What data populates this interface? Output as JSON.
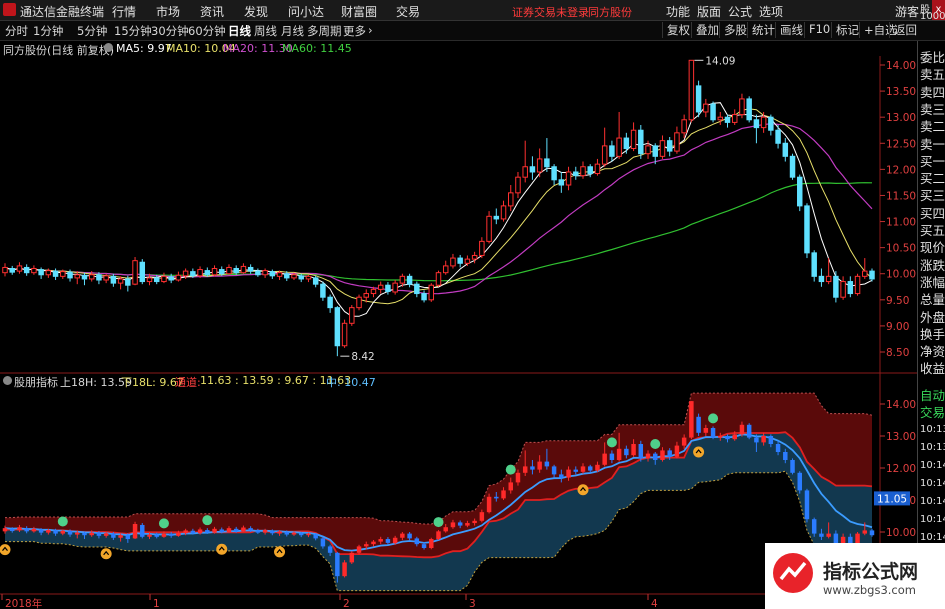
{
  "app": {
    "title": "通达信金融终端",
    "menu": [
      "行情",
      "市场",
      "资讯",
      "发现",
      "问小达",
      "财富圈",
      "交易"
    ],
    "notice": "证券交易未登录",
    "stock_name": "同方股份",
    "right_menu": [
      "功能",
      "版面",
      "公式",
      "选项"
    ],
    "user": "游客",
    "close_label": "x"
  },
  "toolbar": {
    "periods": [
      "分时",
      "1分钟",
      "5分钟",
      "15分钟",
      "30分钟",
      "60分钟",
      "日线",
      "周线",
      "月线",
      "多周期",
      "更多"
    ],
    "active_period": "日线",
    "more_arrow": "›",
    "buttons": [
      "复权",
      "叠加",
      "多股",
      "统计",
      "画线",
      "F10",
      "标记",
      "+自选",
      "返回"
    ]
  },
  "main_info": {
    "title": "同方股份(日线 前复权)",
    "ma5": "MA5: 9.97",
    "ma10": "MA10: 10.04",
    "ma20": "MA20: 11.30",
    "ma60": "MA60: 11.45"
  },
  "indicator_info": {
    "name": "股朋指标",
    "upper": "上18H: 13.59",
    "lower": "下18L: 9.67",
    "channel_label": "通道:",
    "channel_values": "11.63 : 13.59 : 9.67 : 11.63",
    "mid": "中: 10.47"
  },
  "side_panel": {
    "top_small": "股",
    "top_small2": "1000",
    "items": [
      "委比",
      "卖五",
      "卖四",
      "卖三",
      "卖二",
      "卖一",
      "买一",
      "买二",
      "买三",
      "买四",
      "买五",
      "现价",
      "涨跌",
      "涨幅",
      "总量",
      "外盘",
      "换手",
      "净资",
      "收益"
    ],
    "lower_items": [
      "自动",
      "交易"
    ],
    "times": [
      "10:13",
      "10:13",
      "10:14",
      "10:14",
      "10:14",
      "10:14",
      "10:14"
    ]
  },
  "axis": {
    "price_ticks": [
      "14.00",
      "13.50",
      "13.00",
      "12.50",
      "12.00",
      "11.50",
      "11.00",
      "10.50",
      "10.00",
      "9.50",
      "9.00",
      "8.50"
    ],
    "ind_ticks": [
      "14.00",
      "13.00",
      "12.00",
      "11.00",
      "10.00"
    ],
    "ind_current": "11.05",
    "x_labels": [
      "2018年",
      "1",
      "2",
      "3",
      "4"
    ],
    "high_label": "14.09",
    "low_label": "8.42"
  },
  "watermark": {
    "title": "指标公式网",
    "url": "www.zbgs3.com"
  },
  "chart_data": {
    "type": "candlestick",
    "ma_legend": [
      "MA5",
      "MA10",
      "MA20",
      "MA60"
    ],
    "ma_values": [
      9.97,
      10.04,
      11.3,
      11.45
    ],
    "colors": {
      "up": "#ff3030",
      "down": "#5fe0ff",
      "ma5": "#ffffff",
      "ma10": "#e8e06a",
      "ma20": "#c23cc2",
      "ma60": "#30c030"
    },
    "candles": [
      {
        "o": 10.02,
        "c": 10.12,
        "h": 10.2,
        "l": 9.95
      },
      {
        "o": 10.1,
        "c": 10.03,
        "h": 10.15,
        "l": 9.98
      },
      {
        "o": 10.05,
        "c": 10.15,
        "h": 10.22,
        "l": 10.0
      },
      {
        "o": 10.12,
        "c": 10.02,
        "h": 10.18,
        "l": 9.96
      },
      {
        "o": 10.02,
        "c": 10.1,
        "h": 10.16,
        "l": 9.98
      },
      {
        "o": 10.08,
        "c": 9.98,
        "h": 10.12,
        "l": 9.9
      },
      {
        "o": 9.98,
        "c": 10.06,
        "h": 10.1,
        "l": 9.92
      },
      {
        "o": 10.05,
        "c": 9.95,
        "h": 10.1,
        "l": 9.88
      },
      {
        "o": 9.95,
        "c": 10.04,
        "h": 10.08,
        "l": 9.9
      },
      {
        "o": 10.03,
        "c": 9.92,
        "h": 10.08,
        "l": 9.85
      },
      {
        "o": 9.92,
        "c": 9.98,
        "h": 10.05,
        "l": 9.8
      },
      {
        "o": 9.97,
        "c": 9.9,
        "h": 10.02,
        "l": 9.78
      },
      {
        "o": 9.9,
        "c": 9.98,
        "h": 10.05,
        "l": 9.85
      },
      {
        "o": 9.98,
        "c": 9.88,
        "h": 10.03,
        "l": 9.8
      },
      {
        "o": 9.88,
        "c": 9.96,
        "h": 10.0,
        "l": 9.82
      },
      {
        "o": 9.95,
        "c": 9.82,
        "h": 10.0,
        "l": 9.75
      },
      {
        "o": 9.82,
        "c": 9.9,
        "h": 9.95,
        "l": 9.7
      },
      {
        "o": 9.9,
        "c": 9.78,
        "h": 9.96,
        "l": 9.66
      },
      {
        "o": 9.8,
        "c": 10.25,
        "h": 10.32,
        "l": 9.78
      },
      {
        "o": 10.22,
        "c": 9.85,
        "h": 10.28,
        "l": 9.8
      },
      {
        "o": 9.85,
        "c": 9.92,
        "h": 10.0,
        "l": 9.78
      },
      {
        "o": 9.92,
        "c": 9.85,
        "h": 9.98,
        "l": 9.8
      },
      {
        "o": 9.85,
        "c": 9.95,
        "h": 10.02,
        "l": 9.82
      },
      {
        "o": 9.94,
        "c": 9.88,
        "h": 10.0,
        "l": 9.82
      },
      {
        "o": 9.88,
        "c": 9.97,
        "h": 10.04,
        "l": 9.85
      },
      {
        "o": 9.96,
        "c": 10.05,
        "h": 10.1,
        "l": 9.9
      },
      {
        "o": 10.04,
        "c": 9.96,
        "h": 10.1,
        "l": 9.92
      },
      {
        "o": 9.96,
        "c": 10.08,
        "h": 10.14,
        "l": 9.92
      },
      {
        "o": 10.06,
        "c": 9.98,
        "h": 10.12,
        "l": 9.94
      },
      {
        "o": 9.98,
        "c": 10.1,
        "h": 10.16,
        "l": 9.95
      },
      {
        "o": 10.08,
        "c": 10.0,
        "h": 10.14,
        "l": 9.96
      },
      {
        "o": 10.0,
        "c": 10.12,
        "h": 10.18,
        "l": 9.98
      },
      {
        "o": 10.1,
        "c": 10.02,
        "h": 10.16,
        "l": 9.98
      },
      {
        "o": 10.02,
        "c": 10.14,
        "h": 10.2,
        "l": 10.0
      },
      {
        "o": 10.12,
        "c": 10.05,
        "h": 10.18,
        "l": 10.0
      },
      {
        "o": 10.05,
        "c": 9.98,
        "h": 10.1,
        "l": 9.94
      },
      {
        "o": 9.98,
        "c": 10.06,
        "h": 10.1,
        "l": 9.92
      },
      {
        "o": 10.04,
        "c": 9.96,
        "h": 10.08,
        "l": 9.9
      },
      {
        "o": 9.95,
        "c": 10.02,
        "h": 10.06,
        "l": 9.88
      },
      {
        "o": 10.0,
        "c": 9.92,
        "h": 10.05,
        "l": 9.86
      },
      {
        "o": 9.92,
        "c": 9.98,
        "h": 10.02,
        "l": 9.88
      },
      {
        "o": 9.96,
        "c": 9.9,
        "h": 10.0,
        "l": 9.84
      },
      {
        "o": 9.9,
        "c": 9.95,
        "h": 9.98,
        "l": 9.84
      },
      {
        "o": 9.92,
        "c": 9.8,
        "h": 9.96,
        "l": 9.74
      },
      {
        "o": 9.8,
        "c": 9.55,
        "h": 9.85,
        "l": 9.48
      },
      {
        "o": 9.55,
        "c": 9.35,
        "h": 9.6,
        "l": 9.25
      },
      {
        "o": 9.35,
        "c": 8.62,
        "h": 9.38,
        "l": 8.42
      },
      {
        "o": 8.62,
        "c": 9.05,
        "h": 9.12,
        "l": 8.58
      },
      {
        "o": 9.05,
        "c": 9.35,
        "h": 9.4,
        "l": 9.0
      },
      {
        "o": 9.35,
        "c": 9.55,
        "h": 9.6,
        "l": 9.3
      },
      {
        "o": 9.55,
        "c": 9.62,
        "h": 9.7,
        "l": 9.45
      },
      {
        "o": 9.62,
        "c": 9.7,
        "h": 9.75,
        "l": 9.55
      },
      {
        "o": 9.7,
        "c": 9.78,
        "h": 9.85,
        "l": 9.62
      },
      {
        "o": 9.78,
        "c": 9.66,
        "h": 9.84,
        "l": 9.6
      },
      {
        "o": 9.65,
        "c": 9.82,
        "h": 9.88,
        "l": 9.6
      },
      {
        "o": 9.82,
        "c": 9.95,
        "h": 10.0,
        "l": 9.75
      },
      {
        "o": 9.95,
        "c": 9.8,
        "h": 10.0,
        "l": 9.74
      },
      {
        "o": 9.8,
        "c": 9.62,
        "h": 9.85,
        "l": 9.55
      },
      {
        "o": 9.62,
        "c": 9.5,
        "h": 9.68,
        "l": 9.45
      },
      {
        "o": 9.5,
        "c": 9.78,
        "h": 9.82,
        "l": 9.46
      },
      {
        "o": 9.78,
        "c": 10.02,
        "h": 10.06,
        "l": 9.75
      },
      {
        "o": 10.02,
        "c": 10.15,
        "h": 10.25,
        "l": 9.98
      },
      {
        "o": 10.15,
        "c": 10.3,
        "h": 10.38,
        "l": 10.1
      },
      {
        "o": 10.3,
        "c": 10.2,
        "h": 10.36,
        "l": 10.12
      },
      {
        "o": 10.2,
        "c": 10.28,
        "h": 10.35,
        "l": 10.15
      },
      {
        "o": 10.28,
        "c": 10.35,
        "h": 10.42,
        "l": 10.2
      },
      {
        "o": 10.35,
        "c": 10.62,
        "h": 10.7,
        "l": 10.3
      },
      {
        "o": 10.62,
        "c": 11.1,
        "h": 11.2,
        "l": 10.58
      },
      {
        "o": 11.1,
        "c": 11.05,
        "h": 11.25,
        "l": 10.95
      },
      {
        "o": 11.05,
        "c": 11.3,
        "h": 11.4,
        "l": 11.0
      },
      {
        "o": 11.3,
        "c": 11.55,
        "h": 11.7,
        "l": 11.2
      },
      {
        "o": 11.55,
        "c": 11.85,
        "h": 11.95,
        "l": 11.45
      },
      {
        "o": 11.85,
        "c": 12.05,
        "h": 12.55,
        "l": 11.75
      },
      {
        "o": 12.05,
        "c": 11.95,
        "h": 12.25,
        "l": 11.8
      },
      {
        "o": 11.95,
        "c": 12.2,
        "h": 12.4,
        "l": 11.85
      },
      {
        "o": 12.2,
        "c": 12.05,
        "h": 12.6,
        "l": 11.95
      },
      {
        "o": 12.05,
        "c": 11.8,
        "h": 12.1,
        "l": 11.7
      },
      {
        "o": 11.8,
        "c": 11.7,
        "h": 11.95,
        "l": 11.55
      },
      {
        "o": 11.7,
        "c": 11.95,
        "h": 12.05,
        "l": 11.6
      },
      {
        "o": 11.95,
        "c": 11.88,
        "h": 12.05,
        "l": 11.8
      },
      {
        "o": 11.88,
        "c": 12.05,
        "h": 12.15,
        "l": 11.82
      },
      {
        "o": 12.05,
        "c": 11.92,
        "h": 12.1,
        "l": 11.85
      },
      {
        "o": 11.92,
        "c": 12.1,
        "h": 12.2,
        "l": 11.88
      },
      {
        "o": 12.1,
        "c": 12.45,
        "h": 12.8,
        "l": 12.05
      },
      {
        "o": 12.45,
        "c": 12.25,
        "h": 12.55,
        "l": 12.15
      },
      {
        "o": 12.25,
        "c": 12.6,
        "h": 13.1,
        "l": 12.2
      },
      {
        "o": 12.6,
        "c": 12.4,
        "h": 12.7,
        "l": 12.3
      },
      {
        "o": 12.4,
        "c": 12.75,
        "h": 12.9,
        "l": 12.35
      },
      {
        "o": 12.75,
        "c": 12.3,
        "h": 12.85,
        "l": 12.2
      },
      {
        "o": 12.3,
        "c": 12.45,
        "h": 12.55,
        "l": 12.2
      },
      {
        "o": 12.45,
        "c": 12.25,
        "h": 12.5,
        "l": 12.1
      },
      {
        "o": 12.25,
        "c": 12.55,
        "h": 12.65,
        "l": 12.2
      },
      {
        "o": 12.55,
        "c": 12.35,
        "h": 12.62,
        "l": 12.25
      },
      {
        "o": 12.35,
        "c": 12.7,
        "h": 12.82,
        "l": 12.3
      },
      {
        "o": 12.7,
        "c": 12.95,
        "h": 13.05,
        "l": 12.6
      },
      {
        "o": 12.95,
        "c": 14.09,
        "h": 14.09,
        "l": 12.9
      },
      {
        "o": 13.6,
        "c": 13.1,
        "h": 13.7,
        "l": 13.0
      },
      {
        "o": 13.1,
        "c": 13.25,
        "h": 13.35,
        "l": 13.0
      },
      {
        "o": 13.25,
        "c": 12.95,
        "h": 13.3,
        "l": 12.9
      },
      {
        "o": 12.95,
        "c": 13.0,
        "h": 13.1,
        "l": 12.85
      },
      {
        "o": 13.0,
        "c": 12.9,
        "h": 13.05,
        "l": 12.8
      },
      {
        "o": 12.9,
        "c": 13.05,
        "h": 13.15,
        "l": 12.85
      },
      {
        "o": 13.05,
        "c": 13.35,
        "h": 13.45,
        "l": 12.98
      },
      {
        "o": 13.35,
        "c": 12.95,
        "h": 13.4,
        "l": 12.9
      },
      {
        "o": 12.95,
        "c": 12.8,
        "h": 13.05,
        "l": 12.5
      },
      {
        "o": 12.8,
        "c": 13.0,
        "h": 13.1,
        "l": 12.7
      },
      {
        "o": 13.0,
        "c": 12.75,
        "h": 13.05,
        "l": 12.65
      },
      {
        "o": 12.75,
        "c": 12.5,
        "h": 12.85,
        "l": 12.4
      },
      {
        "o": 12.5,
        "c": 12.25,
        "h": 12.6,
        "l": 12.15
      },
      {
        "o": 12.25,
        "c": 11.85,
        "h": 12.3,
        "l": 11.8
      },
      {
        "o": 11.85,
        "c": 11.3,
        "h": 11.9,
        "l": 11.2
      },
      {
        "o": 11.3,
        "c": 10.4,
        "h": 11.35,
        "l": 10.3
      },
      {
        "o": 10.4,
        "c": 9.95,
        "h": 10.45,
        "l": 9.85
      },
      {
        "o": 9.95,
        "c": 9.85,
        "h": 10.1,
        "l": 9.75
      },
      {
        "o": 9.85,
        "c": 9.95,
        "h": 10.3,
        "l": 9.8
      },
      {
        "o": 9.95,
        "c": 9.55,
        "h": 10.05,
        "l": 9.45
      },
      {
        "o": 9.55,
        "c": 9.85,
        "h": 9.95,
        "l": 9.5
      },
      {
        "o": 9.85,
        "c": 9.62,
        "h": 9.95,
        "l": 9.55
      },
      {
        "o": 9.62,
        "c": 9.95,
        "h": 10.0,
        "l": 9.58
      },
      {
        "o": 9.95,
        "c": 10.05,
        "h": 10.3,
        "l": 9.9
      },
      {
        "o": 10.05,
        "c": 9.9,
        "h": 10.1,
        "l": 9.85
      }
    ]
  }
}
